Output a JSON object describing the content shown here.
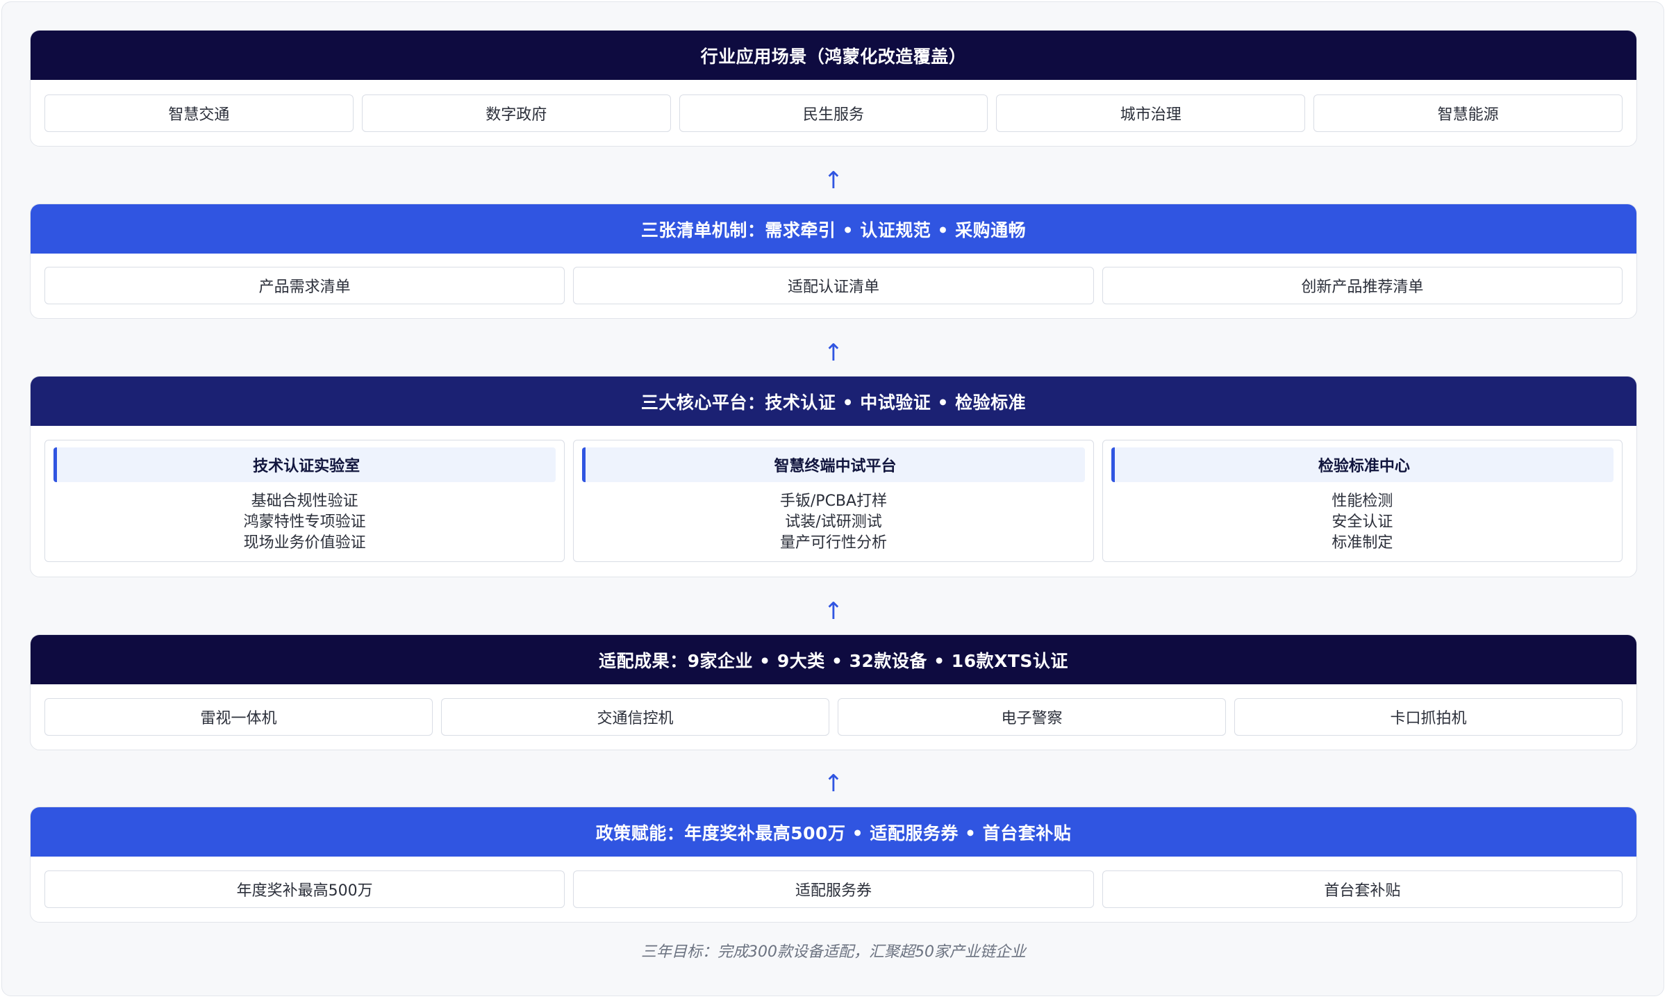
{
  "layers": [
    {
      "title": "行业应用场景（鸿蒙化改造覆盖）",
      "items": [
        "智慧交通",
        "数字政府",
        "民生服务",
        "城市治理",
        "智慧能源"
      ]
    },
    {
      "title": "三张清单机制：需求牵引 • 认证规范 • 采购通畅",
      "items": [
        "产品需求清单",
        "适配认证清单",
        "创新产品推荐清单"
      ]
    },
    {
      "title": "三大核心平台：技术认证 • 中试验证 • 检验标准",
      "cards": [
        {
          "title": "技术认证实验室",
          "lines": [
            "基础合规性验证",
            "鸿蒙特性专项验证",
            "现场业务价值验证"
          ]
        },
        {
          "title": "智慧终端中试平台",
          "lines": [
            "手钣/PCBA打样",
            "试装/试研测试",
            "量产可行性分析"
          ]
        },
        {
          "title": "检验标准中心",
          "lines": [
            "性能检测",
            "安全认证",
            "标准制定"
          ]
        }
      ]
    },
    {
      "title": "适配成果：9家企业 • 9大类 • 32款设备 • 16款XTS认证",
      "items": [
        "雷视一体机",
        "交通信控机",
        "电子警察",
        "卡口抓拍机"
      ]
    },
    {
      "title": "政策赋能：年度奖补最高500万 • 适配服务券 • 首台套补贴",
      "items": [
        "年度奖补最高500万",
        "适配服务券",
        "首台套补贴"
      ]
    }
  ],
  "arrow_glyph": "↑",
  "footer": "三年目标：完成300款设备适配，汇聚超50家产业链企业",
  "colors": {
    "dark_header": "#0e0b40",
    "blue_header": "#3055e1",
    "navy_header": "#1b2173",
    "arrow": "#3055e1"
  }
}
